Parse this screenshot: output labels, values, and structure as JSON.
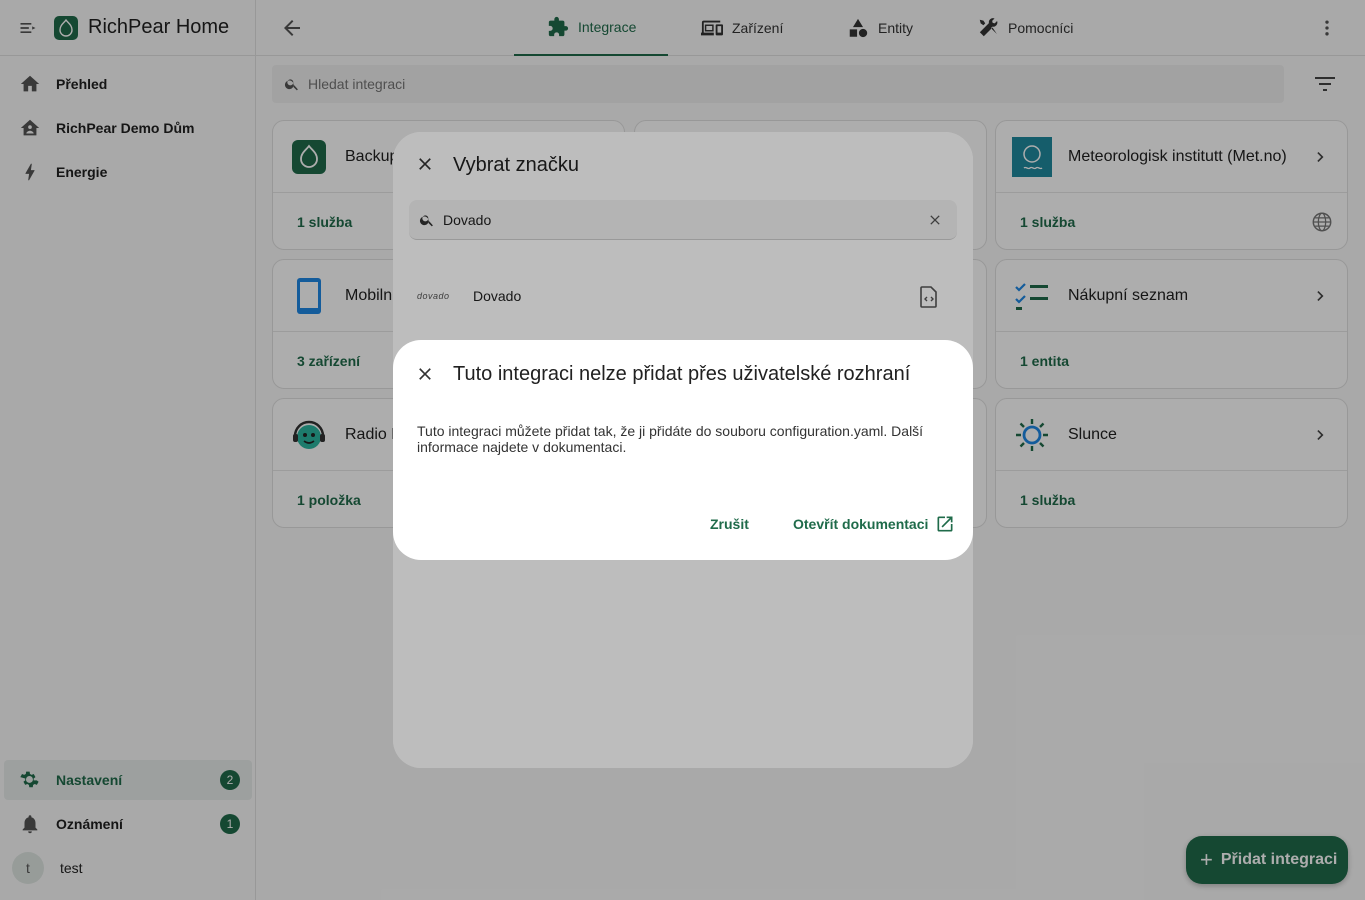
{
  "app": {
    "title": "RichPear Home"
  },
  "sidebar": {
    "items": [
      {
        "label": "Přehled"
      },
      {
        "label": "RichPear Demo Dům"
      },
      {
        "label": "Energie"
      }
    ],
    "bottom": [
      {
        "label": "Nastavení",
        "badge": "2"
      },
      {
        "label": "Oznámení",
        "badge": "1"
      }
    ],
    "user": {
      "initial": "t",
      "name": "test"
    }
  },
  "tabs": [
    {
      "label": "Integrace",
      "icon": "puzzle-icon",
      "active": true
    },
    {
      "label": "Zařízení",
      "icon": "devices-icon"
    },
    {
      "label": "Entity",
      "icon": "shapes-icon"
    },
    {
      "label": "Pomocníci",
      "icon": "tools-icon"
    }
  ],
  "search": {
    "placeholder": "Hledat integraci"
  },
  "cards": [
    {
      "title": "Backup",
      "footer": "1 služba"
    },
    {
      "title": "Meteorologisk institutt (Met.no)",
      "footer": "1 služba"
    },
    {
      "title": "Mobiln",
      "footer": "3 zařízení"
    },
    {
      "title": "Nákupní seznam",
      "footer": "1 entita"
    },
    {
      "title": "Radio B",
      "footer": "1 položka"
    },
    {
      "title": "Slunce",
      "footer": "1 služba"
    }
  ],
  "fab": {
    "label": "Přidat integraci"
  },
  "brand_dialog": {
    "title": "Vybrat značku",
    "search_value": "Dovado",
    "result": {
      "logo_text": "dovado",
      "name": "Dovado"
    }
  },
  "alert": {
    "title": "Tuto integraci nelze přidat přes uživatelské rozhraní",
    "text": "Tuto integraci můžete přidat tak, že ji přidáte do souboru configuration.yaml. Další informace najdete v dokumentaci.",
    "cancel": "Zrušit",
    "open_docs": "Otevřít dokumentaci"
  },
  "colors": {
    "primary": "#1f6b4a",
    "metno": "#1f8a9e",
    "mobile": "#1e88e5"
  }
}
